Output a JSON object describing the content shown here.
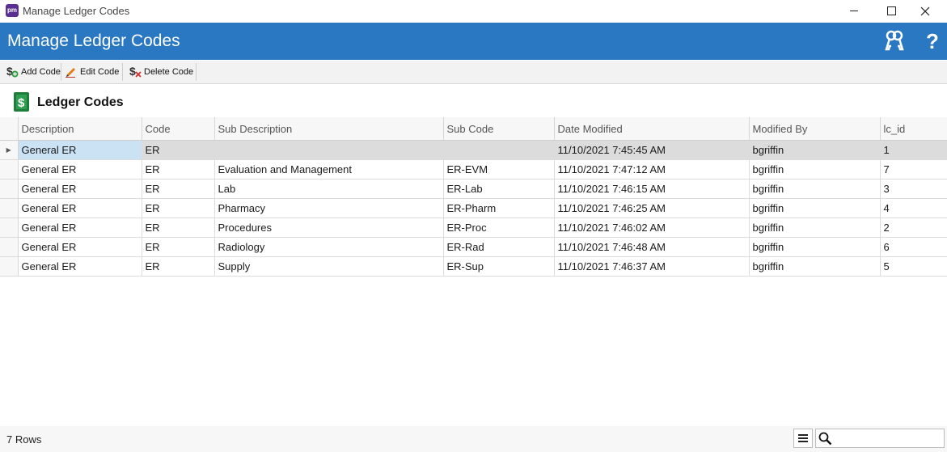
{
  "window": {
    "title": "Manage Ledger Codes",
    "app_icon": "pm-app-icon"
  },
  "header": {
    "title": "Manage Ledger Codes",
    "icons": [
      "keys-icon",
      "help-icon"
    ],
    "help_glyph": "?"
  },
  "toolbar": {
    "add_label": "Add Code",
    "edit_label": "Edit Code",
    "delete_label": "Delete Code"
  },
  "section": {
    "title": "Ledger Codes"
  },
  "grid": {
    "columns": [
      "Description",
      "Code",
      "Sub Description",
      "Sub Code",
      "Date Modified",
      "Modified By",
      "lc_id"
    ],
    "rows": [
      [
        "General ER",
        "ER",
        "",
        "",
        "11/10/2021 7:45:45 AM",
        "bgriffin",
        "1"
      ],
      [
        "General ER",
        "ER",
        "Evaluation and Management",
        "ER-EVM",
        "11/10/2021 7:47:12 AM",
        "bgriffin",
        "7"
      ],
      [
        "General ER",
        "ER",
        "Lab",
        "ER-Lab",
        "11/10/2021 7:46:15 AM",
        "bgriffin",
        "3"
      ],
      [
        "General ER",
        "ER",
        "Pharmacy",
        "ER-Pharm",
        "11/10/2021 7:46:25 AM",
        "bgriffin",
        "4"
      ],
      [
        "General ER",
        "ER",
        "Procedures",
        "ER-Proc",
        "11/10/2021 7:46:02 AM",
        "bgriffin",
        "2"
      ],
      [
        "General ER",
        "ER",
        "Radiology",
        "ER-Rad",
        "11/10/2021 7:46:48 AM",
        "bgriffin",
        "6"
      ],
      [
        "General ER",
        "ER",
        "Supply",
        "ER-Sup",
        "11/10/2021 7:46:37 AM",
        "bgriffin",
        "5"
      ]
    ]
  },
  "status": {
    "row_count": "7 Rows",
    "search_placeholder": ""
  },
  "colors": {
    "header_blue": "#2a78c2",
    "selected_cell": "#cbe2f5",
    "current_row": "#dcdcdc"
  }
}
